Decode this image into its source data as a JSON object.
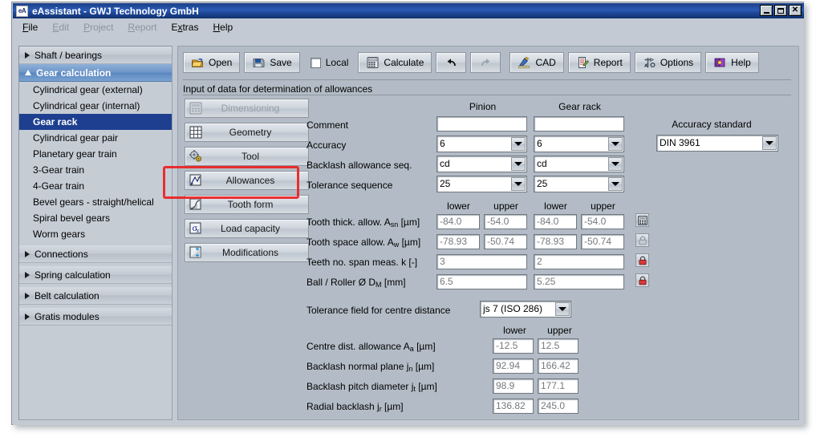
{
  "window": {
    "title": "eAssistant - GWJ Technology GmbH",
    "app_icon_label": "eA",
    "controls": {
      "minimize": "Minimize",
      "maximize": "Maximize",
      "close": "Close"
    }
  },
  "menubar": {
    "items": [
      {
        "label": "File",
        "enabled": true
      },
      {
        "label": "Edit",
        "enabled": false
      },
      {
        "label": "Project",
        "enabled": false
      },
      {
        "label": "Report",
        "enabled": false
      },
      {
        "label": "Extras",
        "enabled": true
      },
      {
        "label": "Help",
        "enabled": true
      }
    ]
  },
  "sidebar": {
    "groups": [
      {
        "label": "Shaft / bearings",
        "expanded": false,
        "active": false
      },
      {
        "label": "Gear calculation",
        "expanded": true,
        "active": true
      },
      {
        "label": "Connections",
        "expanded": false,
        "active": false
      },
      {
        "label": "Spring calculation",
        "expanded": false,
        "active": false
      },
      {
        "label": "Belt calculation",
        "expanded": false,
        "active": false
      },
      {
        "label": "Gratis modules",
        "expanded": false,
        "active": false
      }
    ],
    "gear_items": [
      {
        "label": "Cylindrical gear (external)",
        "selected": false
      },
      {
        "label": "Cylindrical gear (internal)",
        "selected": false
      },
      {
        "label": "Gear rack",
        "selected": true
      },
      {
        "label": "Cylindrical gear pair",
        "selected": false
      },
      {
        "label": "Planetary gear train",
        "selected": false
      },
      {
        "label": "3-Gear train",
        "selected": false
      },
      {
        "label": "4-Gear train",
        "selected": false
      },
      {
        "label": "Bevel gears - straight/helical",
        "selected": false
      },
      {
        "label": "Spiral bevel gears",
        "selected": false
      },
      {
        "label": "Worm gears",
        "selected": false
      }
    ]
  },
  "toolbar": {
    "open_label": "Open",
    "save_label": "Save",
    "local_label": "Local",
    "local_checked": false,
    "calculate_label": "Calculate",
    "undo_label": "",
    "redo_label": "",
    "cad_label": "CAD",
    "report_label": "Report",
    "options_label": "Options",
    "help_label": "Help",
    "icons": {
      "open": "open-folder-icon",
      "save": "floppy-disk-icon",
      "calculate": "calculator-icon",
      "undo": "undo-arrow-icon",
      "redo": "redo-arrow-icon",
      "cad": "cad-pencil-ruler-icon",
      "report": "report-document-icon",
      "options": "options-tools-icon",
      "help": "help-book-icon"
    }
  },
  "caption": "Input of data for determination of allowances",
  "tabs": [
    {
      "label": "Dimensioning",
      "icon": "dimensioning-icon",
      "enabled": false,
      "active": false
    },
    {
      "label": "Geometry",
      "icon": "geometry-grid-icon",
      "enabled": true,
      "active": false
    },
    {
      "label": "Tool",
      "icon": "tool-gear-icon",
      "enabled": true,
      "active": false
    },
    {
      "label": "Allowances",
      "icon": "allowances-chart-icon",
      "enabled": true,
      "active": true
    },
    {
      "label": "Tooth form",
      "icon": "tooth-form-icon",
      "enabled": true,
      "active": false
    },
    {
      "label": "Load capacity",
      "icon": "load-capacity-sigma-icon",
      "enabled": true,
      "active": false
    },
    {
      "label": "Modifications",
      "icon": "modifications-icon",
      "enabled": true,
      "active": false
    }
  ],
  "form": {
    "column_headers": {
      "pinion": "Pinion",
      "gear_rack": "Gear rack"
    },
    "accuracy_standard": {
      "label": "Accuracy standard",
      "value": "DIN 3961"
    },
    "rows_top": [
      {
        "label": "Comment",
        "icon": "",
        "pinion": "",
        "rack": "",
        "type": "text"
      },
      {
        "label": "Accuracy",
        "pinion": "6",
        "rack": "6",
        "type": "combo"
      },
      {
        "label": "Backlash allowance seq.",
        "pinion": "cd",
        "rack": "cd",
        "type": "combo"
      },
      {
        "label": "Tolerance sequence",
        "pinion": "25",
        "rack": "25",
        "type": "combo"
      }
    ],
    "lower_upper_headers": {
      "lower": "lower",
      "upper": "upper"
    },
    "rows_allowance": [
      {
        "label_main": "Tooth thick. allow. A",
        "label_sub": "sn",
        "label_unit": " [µm]",
        "pinion_lower": "-84.0",
        "pinion_upper": "-54.0",
        "rack_lower": "-84.0",
        "rack_upper": "-54.0",
        "split": true,
        "side_icon": "calculator-icon"
      },
      {
        "label_main": "Tooth space allow. A",
        "label_sub": "w",
        "label_unit": " [µm]",
        "pinion_lower": "-78.93",
        "pinion_upper": "-50.74",
        "rack_lower": "-78.93",
        "rack_upper": "-50.74",
        "split": true,
        "side_icon": "lock-open-grey-icon"
      },
      {
        "label_main": "Teeth no. span meas. k [-]",
        "label_sub": "",
        "label_unit": "",
        "pinion_single": "3",
        "rack_single": "2",
        "split": false,
        "side_icon": "lock-closed-red-icon"
      },
      {
        "label_main": "Ball / Roller Ø D",
        "label_sub": "M",
        "label_unit": " [mm]",
        "pinion_single": "6.5",
        "rack_single": "5.25",
        "split": false,
        "side_icon": "lock-closed-red-icon"
      }
    ],
    "tolerance_field": {
      "label": "Tolerance field for centre distance",
      "value": "js 7 (ISO 286)"
    },
    "bottom_headers": {
      "lower": "lower",
      "upper": "upper"
    },
    "rows_bottom": [
      {
        "label_main": "Centre dist. allowance A",
        "label_sub": "a",
        "label_unit": " [µm]",
        "lower": "-12.5",
        "upper": "12.5"
      },
      {
        "label_main": "Backlash normal plane j",
        "label_sub": "n",
        "label_unit": " [µm]",
        "lower": "92.94",
        "upper": "166.42"
      },
      {
        "label_main": "Backlash pitch diameter j",
        "label_sub": "t",
        "label_unit": " [µm]",
        "lower": "98.9",
        "upper": "177.1"
      },
      {
        "label_main": "Radial backlash j",
        "label_sub": "r",
        "label_unit": " [µm]",
        "lower": "136.82",
        "upper": "245.0"
      }
    ]
  },
  "annotation": {
    "color": "#ec2121",
    "target": "Allowances"
  }
}
